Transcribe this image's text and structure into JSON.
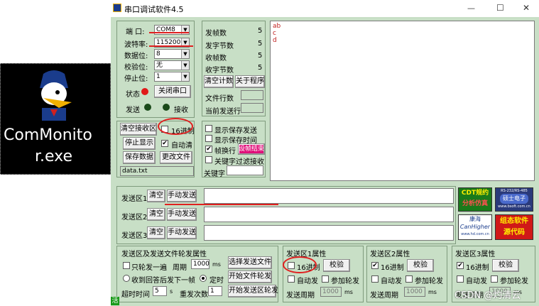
{
  "desktop": {
    "exe_name_1": "ComMonito",
    "exe_name_2": "r.exe"
  },
  "window": {
    "title": "串口调试软件4.5",
    "controls": {
      "minimize": "—",
      "maximize": "☐",
      "close": "✕"
    }
  },
  "port": {
    "port_label": "端 口:",
    "port_value": "COM8",
    "baud_label": "波特率:",
    "baud_value": "115200",
    "data_label": "数据位:",
    "data_value": "8",
    "parity_label": "校验位:",
    "parity_value": "无",
    "stop_label": "停止位:",
    "stop_value": "1",
    "status_label": "状态",
    "close_port": "关闭串口",
    "send_label": "发送",
    "recv_label": "接收"
  },
  "stats": {
    "sent_frames_label": "发帧数",
    "sent_frames": "5",
    "sent_bytes_label": "发字节数",
    "sent_bytes": "5",
    "recv_frames_label": "收帧数",
    "recv_frames": "5",
    "recv_bytes_label": "收字节数",
    "recv_bytes": "5",
    "clear_count": "清空计数",
    "about": "关于程序",
    "file_lines_label": "文件行数",
    "current_line_label": "当前发送行"
  },
  "receive": {
    "clear_recv": "清空接收区",
    "hex16": "16进制",
    "stop_display": "停止显示",
    "auto_clear": "自动清",
    "save_data": "保存数据",
    "change_file": "更改文件",
    "file_name": "data.txt",
    "text_lines": [
      "ab",
      "c",
      "d"
    ]
  },
  "display": {
    "show_saved_sent": "显示保存发送",
    "show_saved_time": "显示保存时间",
    "frame_newline": "帧换行",
    "frame_end_btn": "设帧结束",
    "keyword_filter": "关键字过滤接收",
    "keyword_label": "关键字"
  },
  "send_areas": [
    {
      "label": "发送区1",
      "clear": "清空",
      "send": "手动发送"
    },
    {
      "label": "发送区2",
      "clear": "清空",
      "send": "手动发送"
    },
    {
      "label": "发送区3",
      "clear": "清空",
      "send": "手动发送"
    }
  ],
  "ads": {
    "cdt_1": "CDT规约",
    "cdt_2": "分析仿真",
    "rs_top": "RS-232/RS-485",
    "rs_mid": "硕士电子",
    "rs_url": "www.bsoft.com.cn",
    "kanghai_1": "康海",
    "kanghai_2": "CanHigher",
    "kanghai_url": "www.hd.com.cn",
    "zutai_1": "组态软件",
    "zutai_2": "源代码"
  },
  "poll": {
    "title": "发送区及发送文件轮发属性",
    "once": "只轮发一遍",
    "period_label": "周期",
    "period_value": "1000",
    "ms": "ms",
    "select_file": "选择发送文件",
    "after_reply": "收到回答后发下一帧",
    "timed": "定时",
    "start_file": "开始文件轮发",
    "timeout_label": "超时时间",
    "timeout_value": "5",
    "s_unit": "s",
    "repeat_label": "重发次数",
    "repeat_value": "1",
    "start_area": "开始发送区轮发"
  },
  "area_props": [
    {
      "title": "发送区1属性",
      "hex": "16进制",
      "hex_checked": false,
      "verify": "校验",
      "auto": "自动发",
      "append": "参加轮发",
      "period_label": "发送周期",
      "period_value": "1000",
      "ms": "ms"
    },
    {
      "title": "发送区2属性",
      "hex": "16进制",
      "hex_checked": true,
      "verify": "校验",
      "auto": "自动发",
      "append": "参加轮发",
      "period_label": "发送周期",
      "period_value": "1000",
      "ms": "ms"
    },
    {
      "title": "发送区3属性",
      "hex": "16进制",
      "hex_checked": true,
      "verify": "校验",
      "auto": "自动发",
      "append": "参加轮发",
      "period_label": "发送周期",
      "period_value": "1000",
      "ms": "ms"
    }
  ],
  "watermark": "CSDN @灼清云",
  "status_corner": "活",
  "colors": {
    "panel": "#c8dfc6",
    "annotation": "#e02020"
  }
}
